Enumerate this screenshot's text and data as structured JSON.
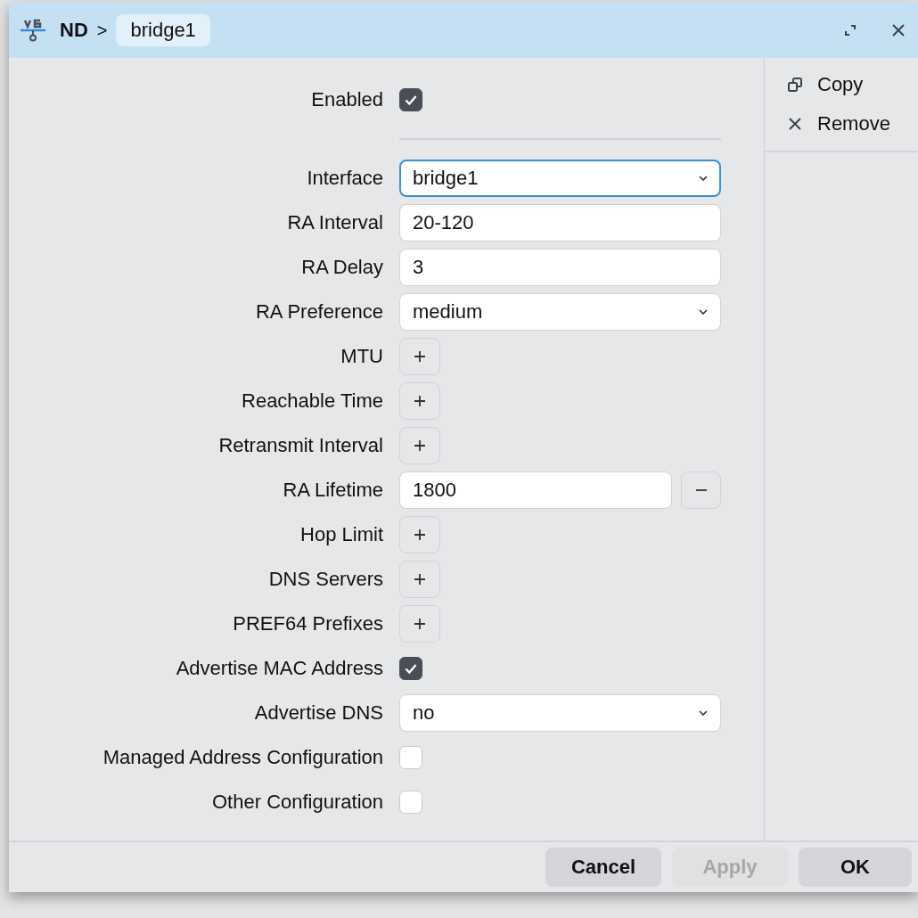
{
  "window": {
    "title": "ND",
    "separator": ">",
    "item": "bridge1"
  },
  "fields": [
    {
      "label": "Enabled",
      "kind": "checkbox",
      "checked": true
    },
    {
      "kind": "separator"
    },
    {
      "label": "Interface",
      "kind": "select",
      "value": "bridge1",
      "focused": true
    },
    {
      "label": "RA Interval",
      "kind": "text",
      "value": "20-120"
    },
    {
      "label": "RA Delay",
      "kind": "text",
      "value": "3"
    },
    {
      "label": "RA Preference",
      "kind": "select",
      "value": "medium",
      "focused": false
    },
    {
      "label": "MTU",
      "kind": "add"
    },
    {
      "label": "Reachable Time",
      "kind": "add"
    },
    {
      "label": "Retransmit Interval",
      "kind": "add"
    },
    {
      "label": "RA Lifetime",
      "kind": "removable",
      "value": "1800"
    },
    {
      "label": "Hop Limit",
      "kind": "add"
    },
    {
      "label": "DNS Servers",
      "kind": "add"
    },
    {
      "label": "PREF64 Prefixes",
      "kind": "add"
    },
    {
      "label": "Advertise MAC Address",
      "kind": "checkbox",
      "checked": true
    },
    {
      "label": "Advertise DNS",
      "kind": "select",
      "value": "no",
      "focused": false
    },
    {
      "label": "Managed Address Configuration",
      "kind": "checkbox",
      "checked": false
    },
    {
      "label": "Other Configuration",
      "kind": "checkbox",
      "checked": false
    }
  ],
  "actions": [
    {
      "label": "Copy",
      "kind": "copy"
    },
    {
      "label": "Remove",
      "kind": "remove"
    }
  ],
  "buttons": [
    {
      "label": "Cancel",
      "disabled": false
    },
    {
      "label": "Apply",
      "disabled": true
    },
    {
      "label": "OK",
      "disabled": false
    }
  ]
}
